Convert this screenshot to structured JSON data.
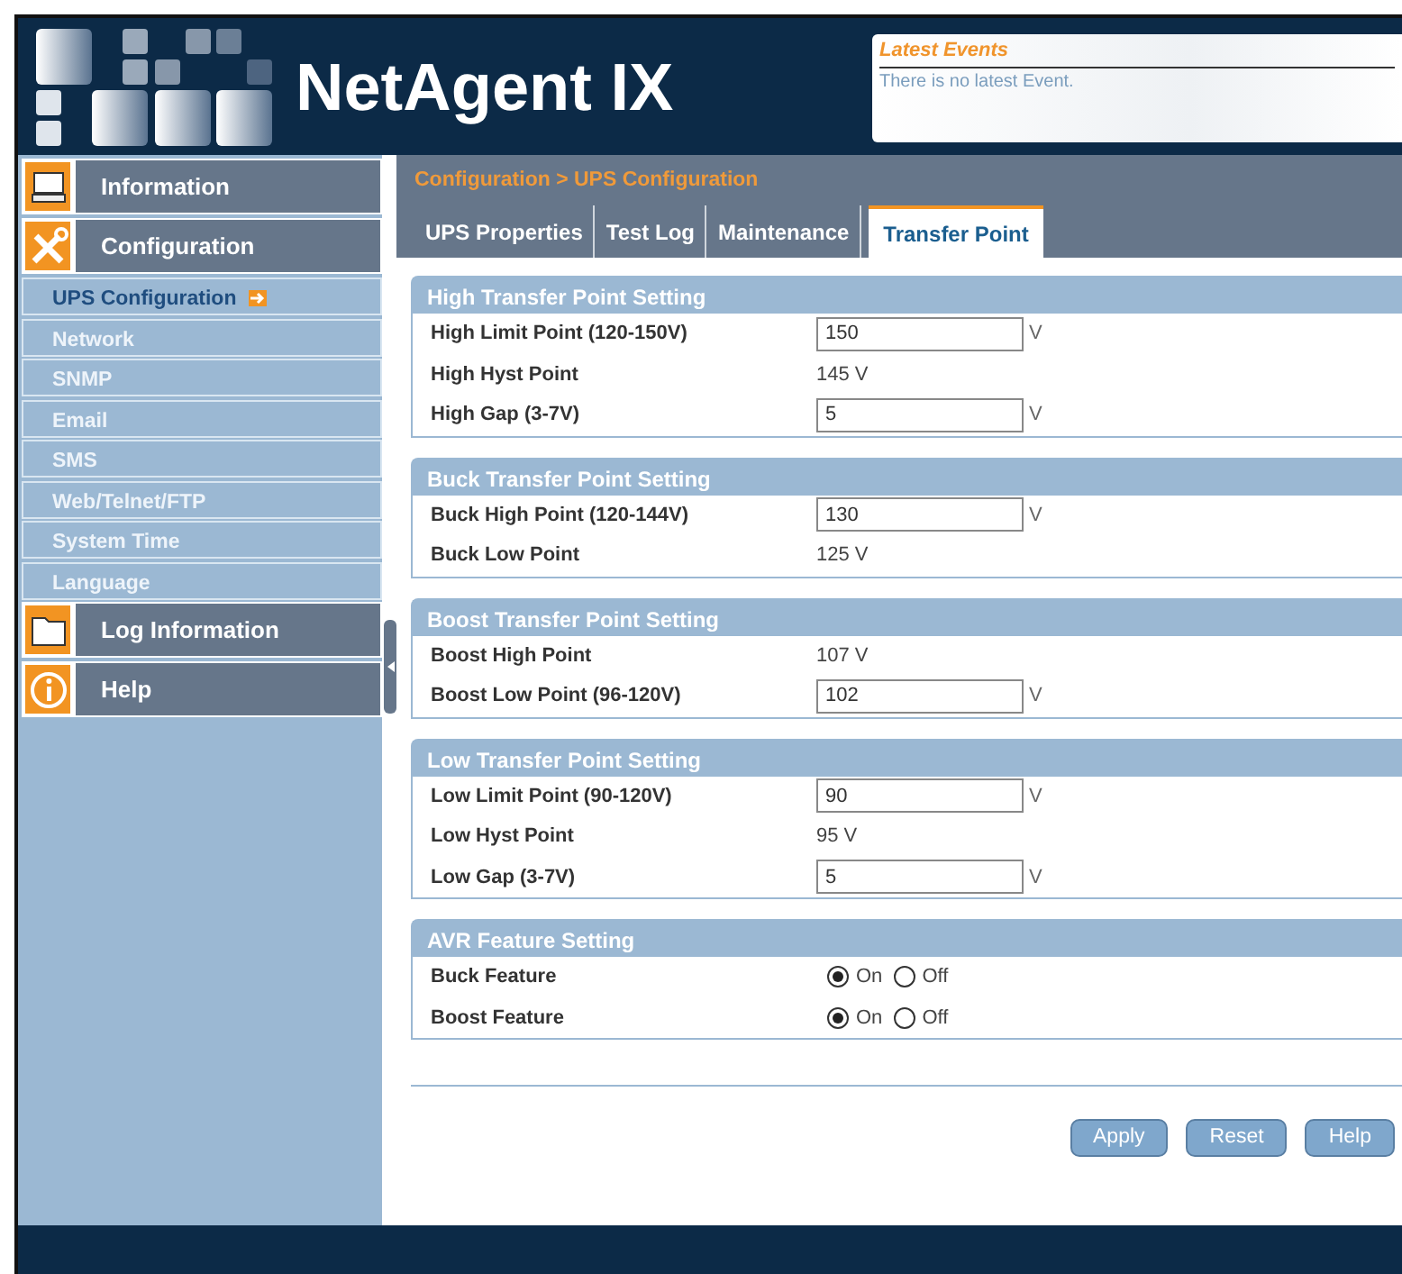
{
  "header": {
    "title": "NetAgent IX",
    "events_title": "Latest Events",
    "events_text": "There is no latest Event."
  },
  "sidebar": [
    {
      "label": "Information"
    },
    {
      "label": "Configuration",
      "children": [
        {
          "label": "UPS Configuration",
          "selected": true
        },
        {
          "label": "Network",
          "selected": false
        },
        {
          "label": "SNMP",
          "selected": false
        },
        {
          "label": "Email",
          "selected": false
        },
        {
          "label": "SMS",
          "selected": false
        },
        {
          "label": "Web/Telnet/FTP",
          "selected": false
        },
        {
          "label": "System Time",
          "selected": false
        },
        {
          "label": "Language",
          "selected": false
        }
      ]
    },
    {
      "label": "Log Information"
    },
    {
      "label": "Help"
    }
  ],
  "breadcrumb": "Configuration > UPS Configuration",
  "tabs": [
    {
      "label": "UPS Properties",
      "selected": false
    },
    {
      "label": "Test Log",
      "selected": false
    },
    {
      "label": "Maintenance",
      "selected": false
    },
    {
      "label": "Transfer Point",
      "selected": true
    }
  ],
  "sections": [
    {
      "title": "High Transfer Point Setting",
      "rows": [
        {
          "kind": "input",
          "label": "High Limit Point (120-150V)",
          "value": "150",
          "unit": "V"
        },
        {
          "kind": "text",
          "label": "High Hyst Point",
          "value": "145 V"
        },
        {
          "kind": "input",
          "label": "High Gap (3-7V)",
          "value": "5",
          "unit": "V"
        }
      ]
    },
    {
      "title": "Buck Transfer Point Setting",
      "rows": [
        {
          "kind": "input",
          "label": "Buck High Point (120-144V)",
          "value": "130",
          "unit": "V"
        },
        {
          "kind": "text",
          "label": "Buck Low Point",
          "value": "125 V"
        }
      ]
    },
    {
      "title": "Boost Transfer Point Setting",
      "rows": [
        {
          "kind": "text",
          "label": "Boost High Point",
          "value": "107 V"
        },
        {
          "kind": "input",
          "label": "Boost Low Point (96-120V)",
          "value": "102",
          "unit": "V"
        }
      ]
    },
    {
      "title": "Low Transfer Point Setting",
      "rows": [
        {
          "kind": "input",
          "label": "Low Limit Point (90-120V)",
          "value": "90",
          "unit": "V"
        },
        {
          "kind": "text",
          "label": "Low Hyst Point",
          "value": "95 V"
        },
        {
          "kind": "input",
          "label": "Low Gap (3-7V)",
          "value": "5",
          "unit": "V"
        }
      ]
    },
    {
      "title": "AVR Feature Setting",
      "rows": [
        {
          "kind": "radio",
          "label": "Buck Feature",
          "options": [
            {
              "label": "On",
              "selected": true
            },
            {
              "label": "Off",
              "selected": false
            }
          ]
        },
        {
          "kind": "radio",
          "label": "Boost Feature",
          "options": [
            {
              "label": "On",
              "selected": true
            },
            {
              "label": "Off",
              "selected": false
            }
          ]
        }
      ]
    }
  ],
  "buttons": [
    "Apply",
    "Reset",
    "Help"
  ]
}
